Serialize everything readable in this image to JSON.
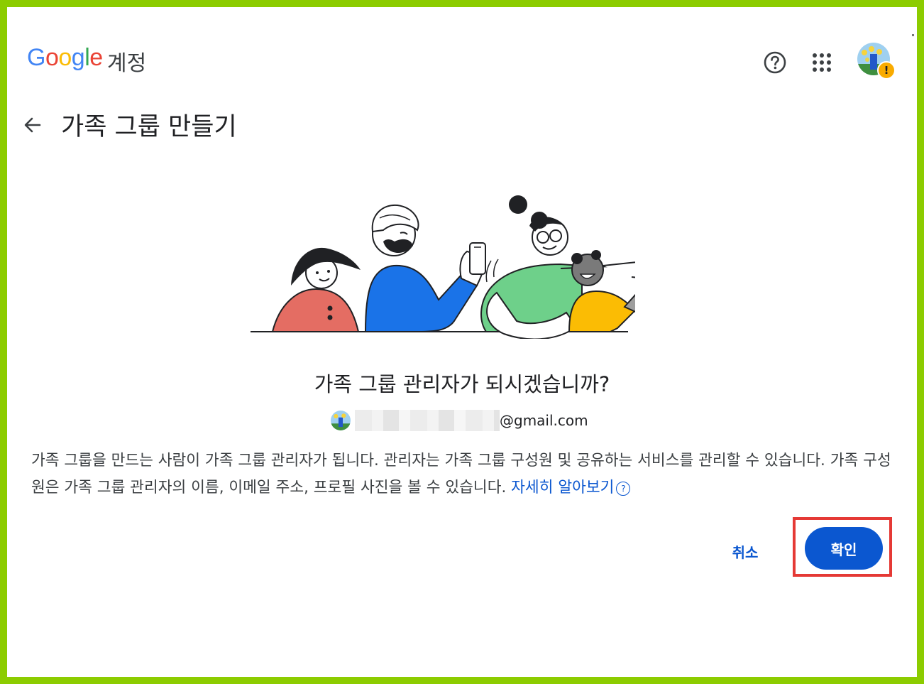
{
  "header": {
    "logo_text": "Google",
    "product_name": "계정",
    "icons": [
      "help-circle-icon",
      "apps-grid-icon",
      "warning-icon"
    ]
  },
  "page": {
    "title": "가족 그룹 만들기",
    "back_icon": "arrow-left-icon"
  },
  "dialog": {
    "question": "가족 그룹 관리자가 되시겠습니까?",
    "account_email_suffix": "@gmail.com",
    "description": "가족 그룹을 만드는 사람이 가족 그룹 관리자가 됩니다. 관리자는 가족 그룹 구성원 및 공유하는 서비스를 관리할 수 있습니다. 가족 구성원은 가족 그룹 관리자의 이름, 이메일 주소, 프로필 사진을 볼 수 있습니다. ",
    "learn_more": "자세히 알아보기",
    "cancel_label": "취소",
    "confirm_label": "확인"
  },
  "colors": {
    "page_bg": "#8ccc00",
    "primary_blue": "#0b57d0",
    "highlight_red": "#e53935",
    "badge_yellow": "#f9ab00",
    "text": "#202124"
  }
}
